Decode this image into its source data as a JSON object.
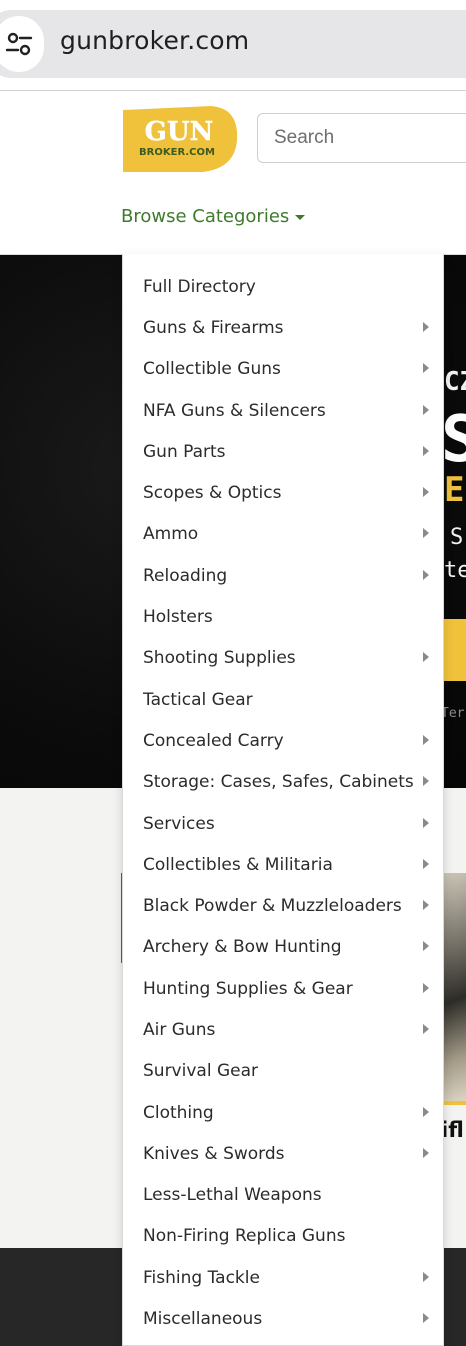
{
  "browser": {
    "url": "gunbroker.com",
    "site_settings_icon": "tune-icon"
  },
  "header": {
    "logo_text_top": "GUN",
    "logo_text_bottom": "BROKER.COM",
    "search_placeholder": "Search",
    "browse_label": "Browse Categories",
    "accent_color": "#3f7a2c",
    "logo_color": "#f0c23b"
  },
  "hero": {
    "frag_cz": "CZ",
    "frag_s": "S",
    "frag_e": "E",
    "frag_s2": "S",
    "frag_te": "te",
    "frag_ter": "Ter"
  },
  "product": {
    "title_fragment": "ifl"
  },
  "menu": {
    "items": [
      {
        "label": "Full Directory",
        "has_submenu": false
      },
      {
        "label": "Guns & Firearms",
        "has_submenu": true
      },
      {
        "label": "Collectible Guns",
        "has_submenu": true
      },
      {
        "label": "NFA Guns & Silencers",
        "has_submenu": true
      },
      {
        "label": "Gun Parts",
        "has_submenu": true
      },
      {
        "label": "Scopes & Optics",
        "has_submenu": true
      },
      {
        "label": "Ammo",
        "has_submenu": true
      },
      {
        "label": "Reloading",
        "has_submenu": true
      },
      {
        "label": "Holsters",
        "has_submenu": false
      },
      {
        "label": "Shooting Supplies",
        "has_submenu": true
      },
      {
        "label": "Tactical Gear",
        "has_submenu": false
      },
      {
        "label": "Concealed Carry",
        "has_submenu": true
      },
      {
        "label": "Storage: Cases, Safes, Cabinets",
        "has_submenu": true
      },
      {
        "label": "Services",
        "has_submenu": true
      },
      {
        "label": "Collectibles & Militaria",
        "has_submenu": true
      },
      {
        "label": "Black Powder & Muzzleloaders",
        "has_submenu": true
      },
      {
        "label": "Archery & Bow Hunting",
        "has_submenu": true
      },
      {
        "label": "Hunting Supplies & Gear",
        "has_submenu": true
      },
      {
        "label": "Air Guns",
        "has_submenu": true
      },
      {
        "label": "Survival Gear",
        "has_submenu": false
      },
      {
        "label": "Clothing",
        "has_submenu": true
      },
      {
        "label": "Knives & Swords",
        "has_submenu": true
      },
      {
        "label": "Less-Lethal Weapons",
        "has_submenu": false
      },
      {
        "label": "Non-Firing Replica Guns",
        "has_submenu": false
      },
      {
        "label": "Fishing Tackle",
        "has_submenu": true
      },
      {
        "label": "Miscellaneous",
        "has_submenu": true
      }
    ]
  }
}
